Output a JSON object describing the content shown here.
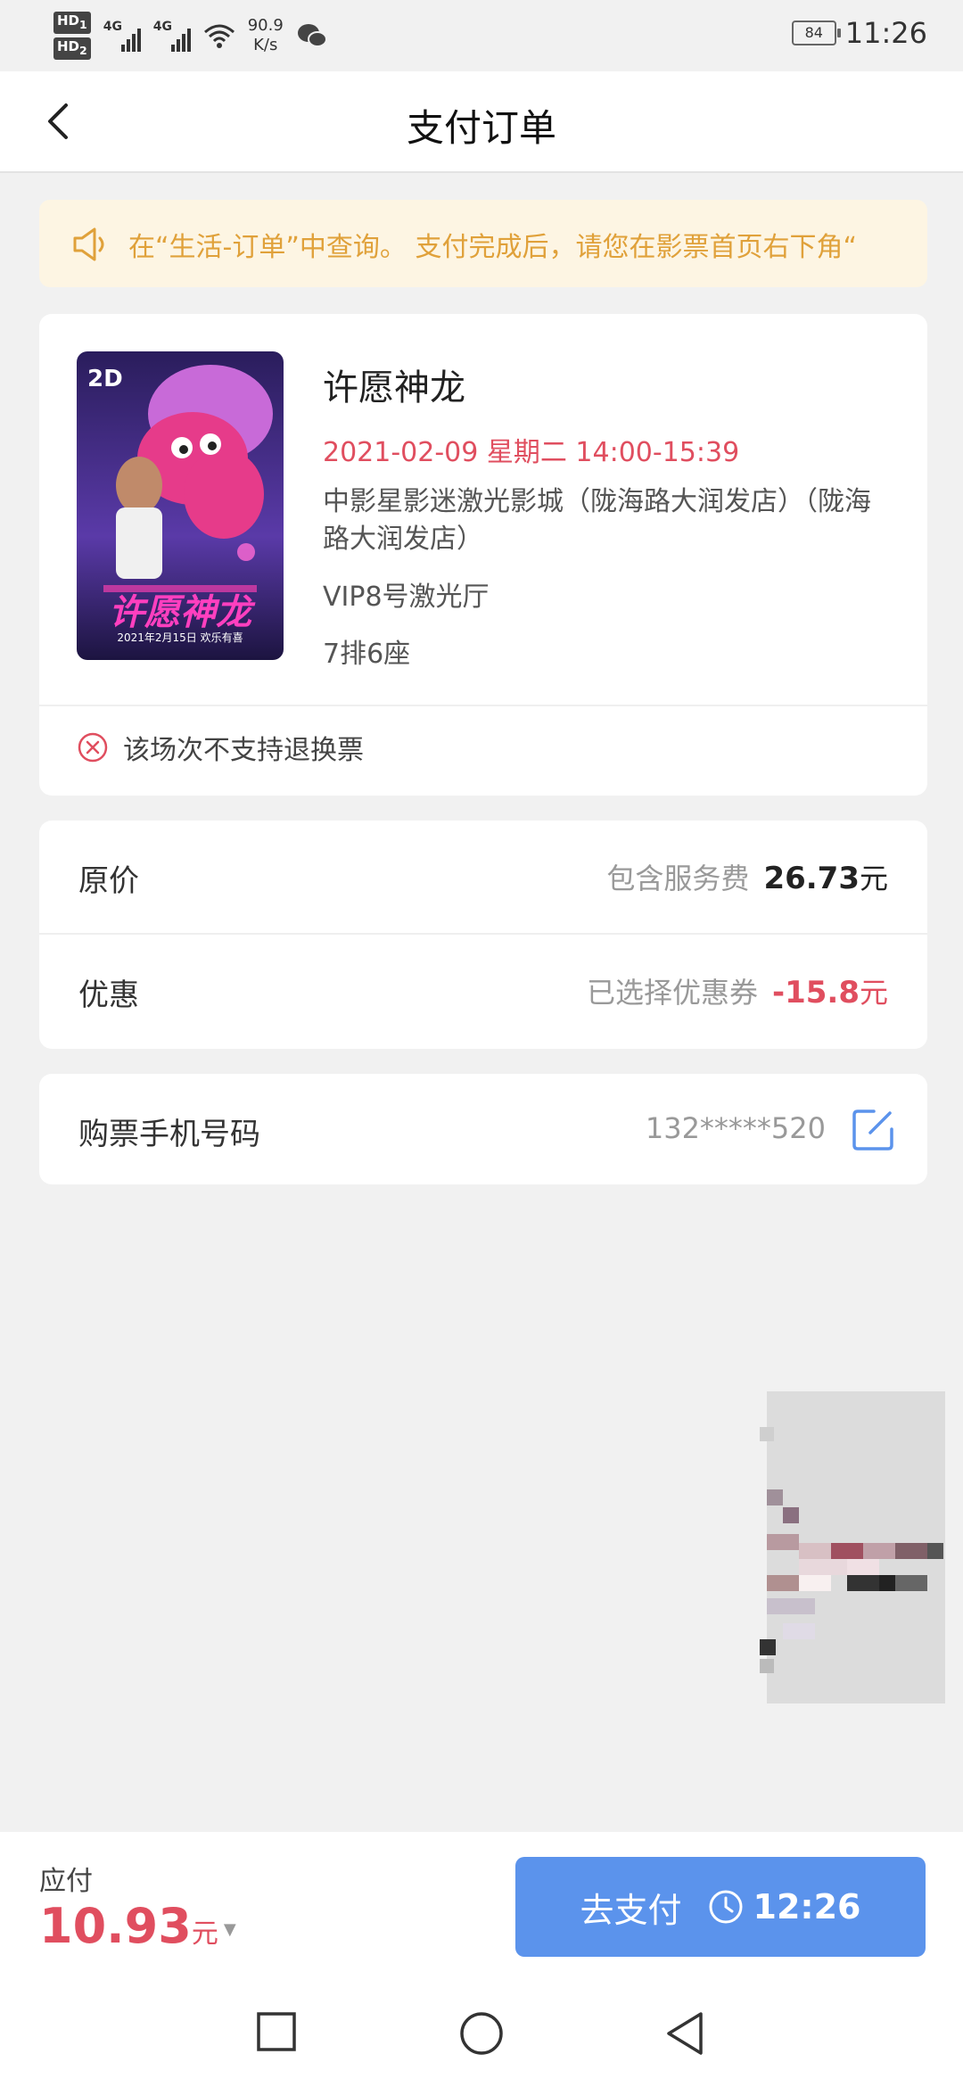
{
  "status_bar": {
    "sim1": "HD",
    "sim1_sub": "1",
    "sim2": "HD",
    "sim2_sub": "2",
    "network1": "4G",
    "network2": "4G",
    "speed_value": "90.9",
    "speed_unit": "K/s",
    "battery": "84",
    "time": "11:26"
  },
  "nav": {
    "title": "支付订单",
    "back_icon": "chevron-left-icon"
  },
  "notice": {
    "icon": "speaker-icon",
    "text": "在“生活-订单”中查询。        支付完成后，请您在影票首页右下角“"
  },
  "movie": {
    "poster_badge": "2D",
    "poster_title": "许愿神龙",
    "poster_date": "2021年2月15日 欢乐有喜",
    "title": "许愿神龙",
    "showtime": "2021-02-09 星期二 14:00-15:39",
    "cinema": "中影星影迷激光影城（陇海路大润发店）（陇海路大润发店）",
    "hall": "VIP8号激光厅",
    "seat": "7排6座",
    "refund_note": "该场次不支持退换票"
  },
  "price": {
    "original_label": "原价",
    "original_note": "包含服务费",
    "original_amount": "26.73",
    "currency": "元",
    "discount_label": "优惠",
    "discount_note": "已选择优惠券",
    "discount_amount": "-15.8"
  },
  "phone": {
    "label": "购票手机号码",
    "number": "132*****520",
    "edit_icon": "edit-icon"
  },
  "footer": {
    "payable_label": "应付",
    "total": "10.93",
    "currency": "元",
    "pay_label": "去支付",
    "timer": "12:26"
  },
  "colors": {
    "accent_red": "#e04e5f",
    "button_blue": "#5b93ec",
    "notice_bg": "#fdf5e3",
    "notice_text": "#e0a13a"
  }
}
